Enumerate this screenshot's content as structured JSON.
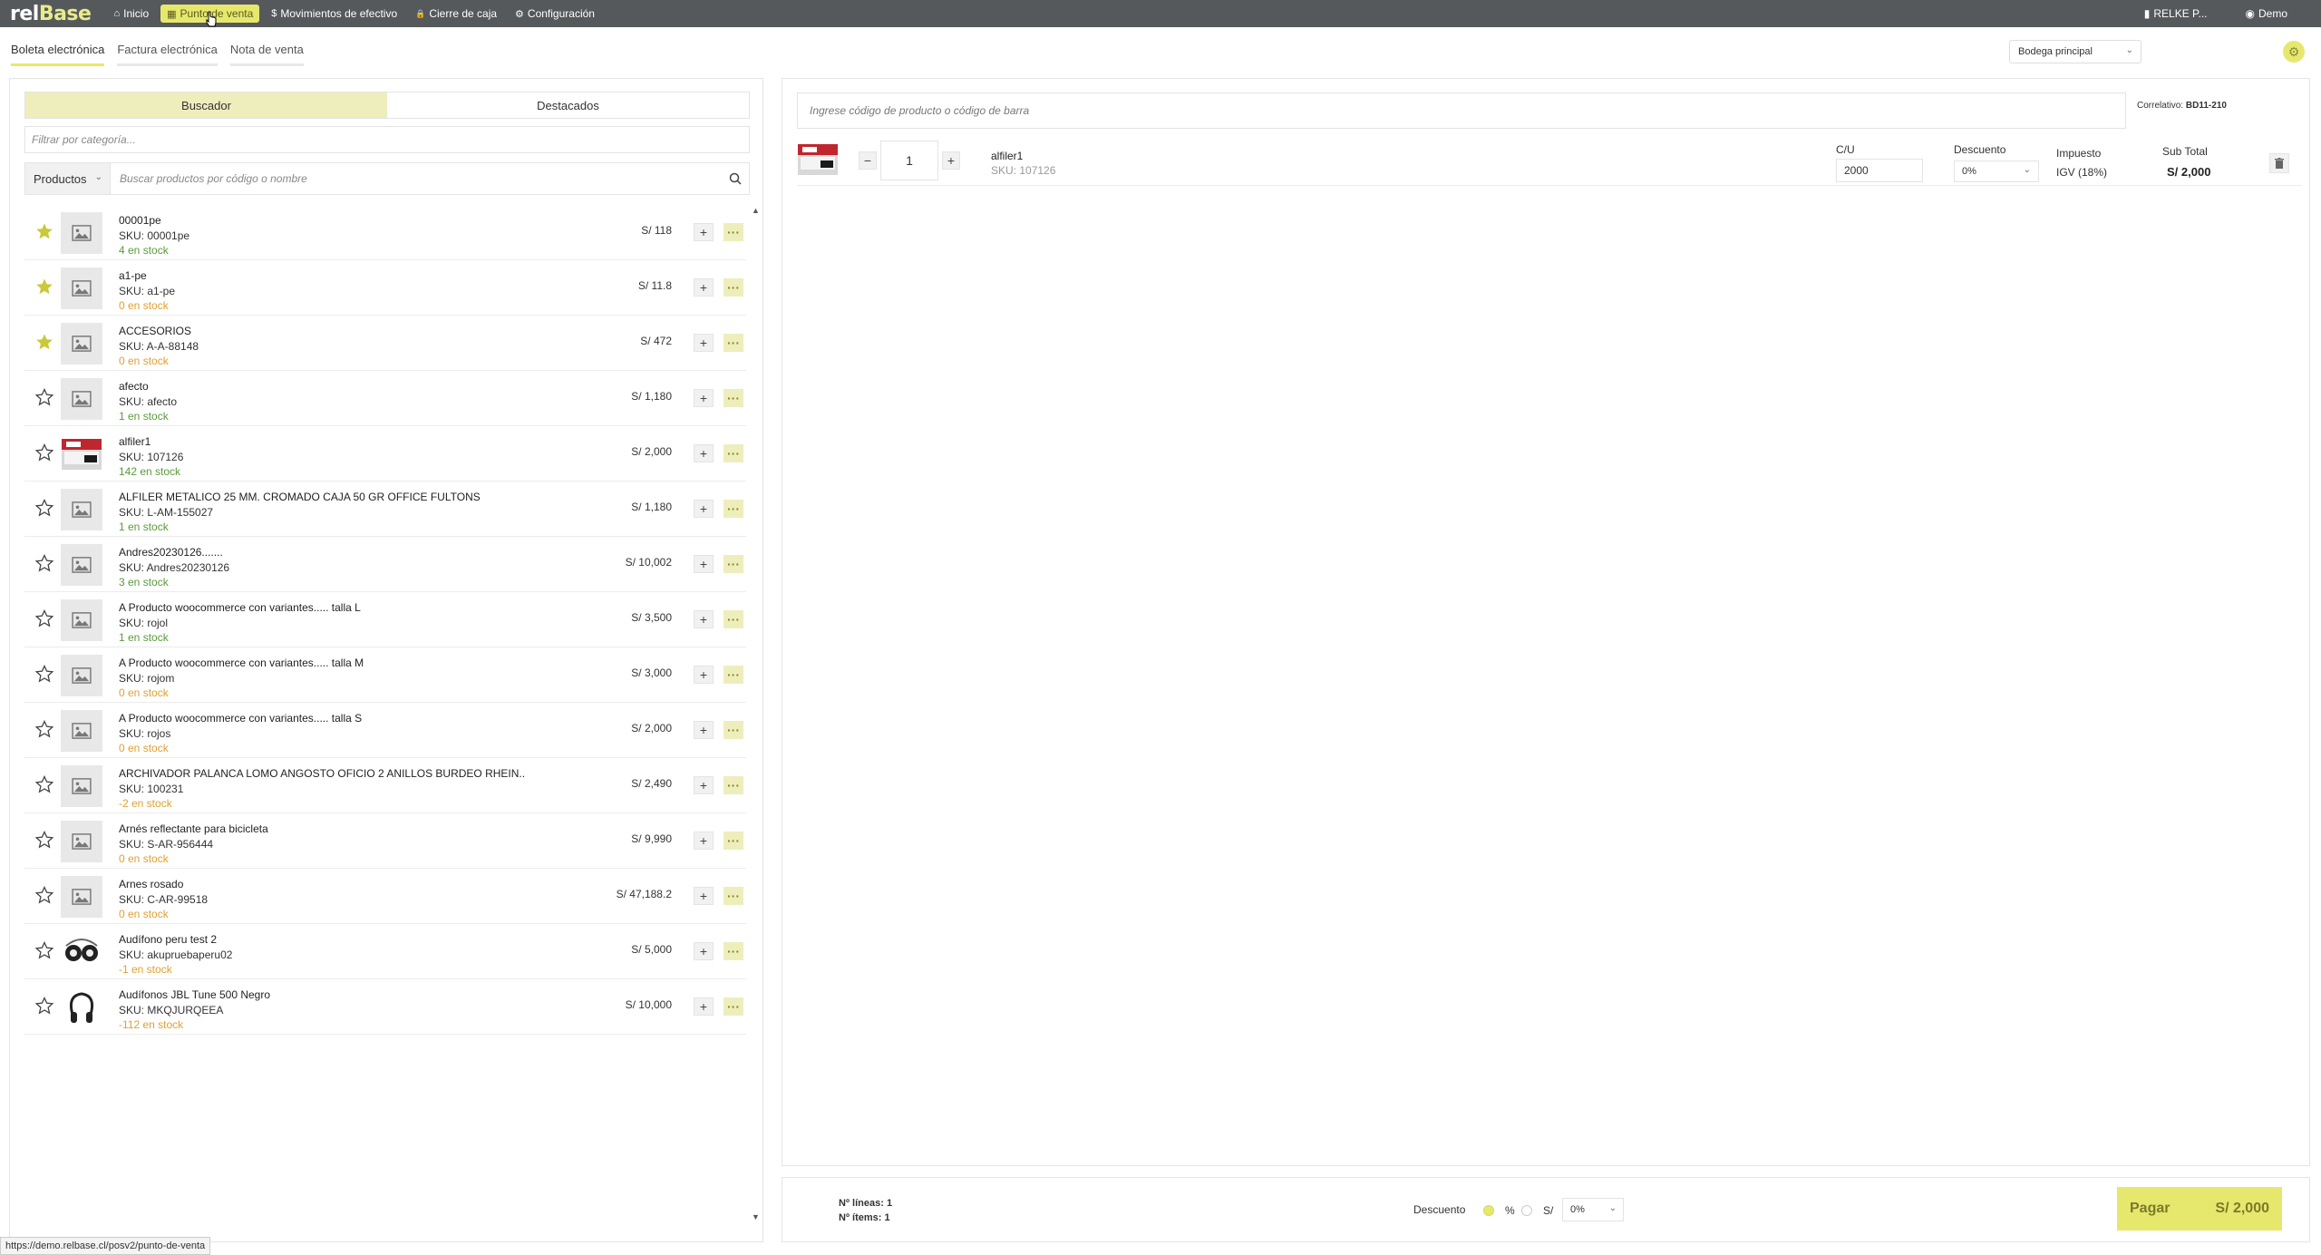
{
  "logo": {
    "part1": "rel",
    "part2": "Base"
  },
  "nav": {
    "items": [
      {
        "icon": "⌂",
        "label": "Inicio",
        "active": false
      },
      {
        "icon": "▦",
        "label": "Punto de venta",
        "active": true
      },
      {
        "icon": "$",
        "label": "Movimientos de efectivo",
        "active": false
      },
      {
        "icon": "🔒",
        "label": "Cierre de caja",
        "active": false
      },
      {
        "icon": "⚙",
        "label": "Configuración",
        "active": false
      }
    ],
    "company": "RELKE P...",
    "user": "Demo"
  },
  "doc_tabs": [
    "Boleta electrónica",
    "Factura electrónica",
    "Nota de venta"
  ],
  "warehouse": "Bodega principal",
  "search_tabs": {
    "finder": "Buscador",
    "featured": "Destacados"
  },
  "category_filter_placeholder": "Filtrar por categoría...",
  "product_type": "Productos",
  "product_search_placeholder": "Buscar productos por código o nombre",
  "products": [
    {
      "name": "00001pe",
      "sku": "SKU: 00001pe",
      "stock": "4 en stock",
      "stock_state": "green",
      "price": "S/ 118",
      "starred": true,
      "thumb": "placeholder"
    },
    {
      "name": "a1-pe",
      "sku": "SKU: a1-pe",
      "stock": "0 en stock",
      "stock_state": "orange",
      "price": "S/ 11.8",
      "starred": true,
      "thumb": "placeholder"
    },
    {
      "name": "ACCESORIOS",
      "sku": "SKU: A-A-88148",
      "stock": "0 en stock",
      "stock_state": "orange",
      "price": "S/ 472",
      "starred": true,
      "thumb": "placeholder"
    },
    {
      "name": "afecto",
      "sku": "SKU: afecto",
      "stock": "1 en stock",
      "stock_state": "green",
      "price": "S/ 1,180",
      "starred": false,
      "thumb": "placeholder"
    },
    {
      "name": "alfiler1",
      "sku": "SKU: 107126",
      "stock": "142 en stock",
      "stock_state": "green",
      "price": "S/ 2,000",
      "starred": false,
      "thumb": "box"
    },
    {
      "name": "ALFILER METALICO 25 MM. CROMADO CAJA 50 GR OFFICE FULTONS",
      "sku": "SKU: L-AM-155027",
      "stock": "1 en stock",
      "stock_state": "green",
      "price": "S/ 1,180",
      "starred": false,
      "thumb": "placeholder"
    },
    {
      "name": "Andres20230126.......",
      "sku": "SKU: Andres20230126",
      "stock": "3 en stock",
      "stock_state": "green",
      "price": "S/ 10,002",
      "starred": false,
      "thumb": "placeholder"
    },
    {
      "name": "A Producto woocommerce con variantes..... talla L",
      "sku": "SKU: rojol",
      "stock": "1 en stock",
      "stock_state": "green",
      "price": "S/ 3,500",
      "starred": false,
      "thumb": "placeholder"
    },
    {
      "name": "A Producto woocommerce con variantes..... talla M",
      "sku": "SKU: rojom",
      "stock": "0 en stock",
      "stock_state": "orange",
      "price": "S/ 3,000",
      "starred": false,
      "thumb": "placeholder"
    },
    {
      "name": "A Producto woocommerce con variantes..... talla S",
      "sku": "SKU: rojos",
      "stock": "0 en stock",
      "stock_state": "orange",
      "price": "S/ 2,000",
      "starred": false,
      "thumb": "placeholder"
    },
    {
      "name": "ARCHIVADOR PALANCA LOMO ANGOSTO OFICIO 2 ANILLOS BURDEO RHEIN..",
      "sku": "SKU: 100231",
      "stock": "-2 en stock",
      "stock_state": "orange",
      "price": "S/ 2,490",
      "starred": false,
      "thumb": "placeholder"
    },
    {
      "name": "Arnés reflectante para bicicleta",
      "sku": "SKU: S-AR-956444",
      "stock": "0 en stock",
      "stock_state": "orange",
      "price": "S/ 9,990",
      "starred": false,
      "thumb": "placeholder"
    },
    {
      "name": "Arnes rosado",
      "sku": "SKU: C-AR-99518",
      "stock": "0 en stock",
      "stock_state": "orange",
      "price": "S/ 47,188.2",
      "starred": false,
      "thumb": "placeholder"
    },
    {
      "name": "Audífono peru test 2",
      "sku": "SKU: akupruebaperu02",
      "stock": "-1 en stock",
      "stock_state": "orange",
      "price": "S/ 5,000",
      "starred": false,
      "thumb": "earbuds"
    },
    {
      "name": "Audífonos JBL Tune 500 Negro",
      "sku": "SKU: MKQJURQEEA",
      "stock": "-112 en stock",
      "stock_state": "orange",
      "price": "S/ 10,000",
      "starred": false,
      "thumb": "headphones"
    }
  ],
  "cart": {
    "barcode_placeholder": "Ingrese código de producto o código de barra",
    "correlativo_label": "Correlativo:",
    "correlativo_value": "BD11-210",
    "col_cu": "C/U",
    "col_discount": "Descuento",
    "col_tax": "Impuesto",
    "col_subtotal": "Sub Total",
    "line": {
      "qty": "1",
      "name": "alfiler1",
      "sku": "SKU: 107126",
      "unit_price": "2000",
      "discount": "0%",
      "tax": "IGV (18%)",
      "subtotal": "S/ 2,000"
    }
  },
  "footer": {
    "lines_label": "Nº líneas:",
    "lines_value": "1",
    "items_label": "Nº ítems:",
    "items_value": "1",
    "discount_label": "Descuento",
    "opt_percent": "%",
    "opt_currency": "S/",
    "discount_value": "0%",
    "pay_label": "Pagar",
    "pay_amount": "S/ 2,000"
  },
  "status_url": "https://demo.relbase.cl/posv2/punto-de-venta",
  "colors": {
    "accent": "#e6e86d",
    "topbar": "#55595c",
    "stock_ok": "#5a9b3b",
    "stock_warn": "#e0a030"
  }
}
